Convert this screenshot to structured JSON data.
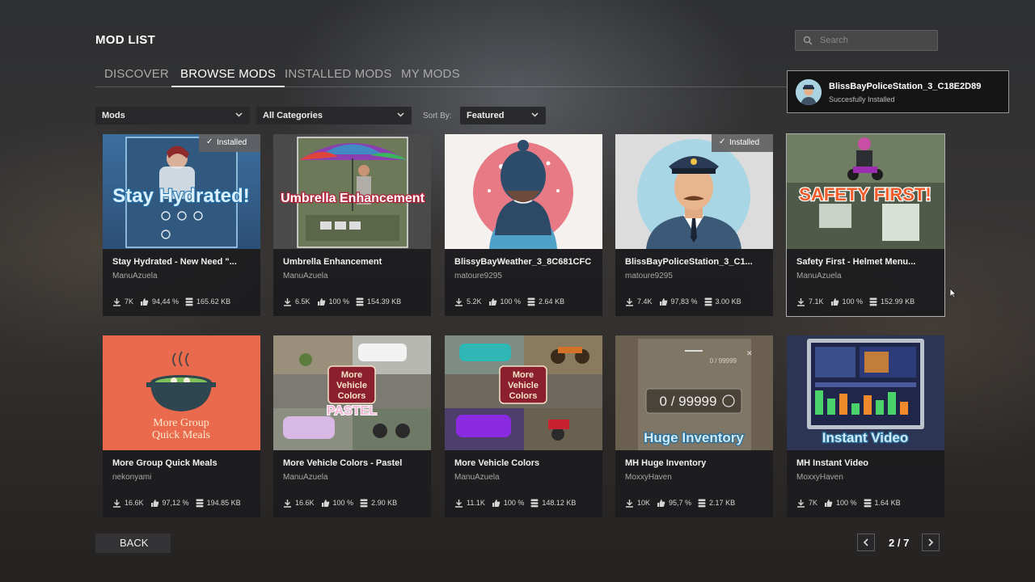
{
  "header": {
    "title": "MOD LIST"
  },
  "tabs": [
    {
      "label": "DISCOVER",
      "active": false
    },
    {
      "label": "BROWSE MODS",
      "active": true
    },
    {
      "label": "INSTALLED MODS",
      "active": false
    },
    {
      "label": "MY MODS",
      "active": false
    }
  ],
  "search": {
    "placeholder": "Search",
    "value": ""
  },
  "notification": {
    "title": "BlissBayPoliceStation_3_C18E2D89",
    "message": "Succesfully Installed"
  },
  "filters": {
    "type": "Mods",
    "category": "All Categories",
    "sort_label": "Sort By:",
    "sort_value": "Featured"
  },
  "badge_label": "Installed",
  "mods": [
    {
      "title": "Stay Hydrated - New Need \"...",
      "author": "ManuAzuela",
      "downloads": "7K",
      "rating": "94,44 %",
      "size": "165.62 KB",
      "installed": true,
      "thumb_text": "Stay Hydrated!"
    },
    {
      "title": "Umbrella Enhancement",
      "author": "ManuAzuela",
      "downloads": "6.5K",
      "rating": "100 %",
      "size": "154.39 KB",
      "installed": false,
      "thumb_text": "Umbrella Enhancement"
    },
    {
      "title": "BlissyBayWeather_3_8C681CFC",
      "author": "matoure9295",
      "downloads": "5.2K",
      "rating": "100 %",
      "size": "2.64 KB",
      "installed": false
    },
    {
      "title": "BlissBayPoliceStation_3_C1...",
      "author": "matoure9295",
      "downloads": "7.4K",
      "rating": "97,83 %",
      "size": "3.00 KB",
      "installed": true
    },
    {
      "title": "Safety First - Helmet Menu...",
      "author": "ManuAzuela",
      "downloads": "7.1K",
      "rating": "100 %",
      "size": "152.99 KB",
      "installed": false,
      "thumb_text": "SAFETY FIRST!"
    },
    {
      "title": "More Group Quick Meals",
      "author": "nekonyami",
      "downloads": "16.6K",
      "rating": "97,12 %",
      "size": "194.85 KB",
      "installed": false,
      "thumb_text": "More Group",
      "thumb_text2": "Quick Meals"
    },
    {
      "title": "More Vehicle Colors - Pastel",
      "author": "ManuAzuela",
      "downloads": "16.6K",
      "rating": "100 %",
      "size": "2.90 KB",
      "installed": false,
      "thumb_text": "More",
      "thumb_text2": "Vehicle",
      "thumb_text3": "Colors",
      "thumb_text4": "PASTEL"
    },
    {
      "title": "More Vehicle Colors",
      "author": "ManuAzuela",
      "downloads": "11.1K",
      "rating": "100 %",
      "size": "148.12 KB",
      "installed": false,
      "thumb_text": "More",
      "thumb_text2": "Vehicle",
      "thumb_text3": "Colors"
    },
    {
      "title": "MH Huge Inventory",
      "author": "MoxxyHaven",
      "downloads": "10K",
      "rating": "95,7 %",
      "size": "2.17 KB",
      "installed": false,
      "thumb_text": "Huge Inventory",
      "thumb_text2": "0 / 99999",
      "thumb_text3": "0 / 99999"
    },
    {
      "title": "MH Instant Video",
      "author": "MoxxyHaven",
      "downloads": "7K",
      "rating": "100 %",
      "size": "1.64 KB",
      "installed": false,
      "thumb_text": "Instant Video"
    }
  ],
  "footer": {
    "back_label": "BACK",
    "page_label": "2 / 7"
  },
  "colors": {
    "accent": "#ffffff",
    "panel": "#1c1c1e",
    "badge": "#5f5f61"
  }
}
